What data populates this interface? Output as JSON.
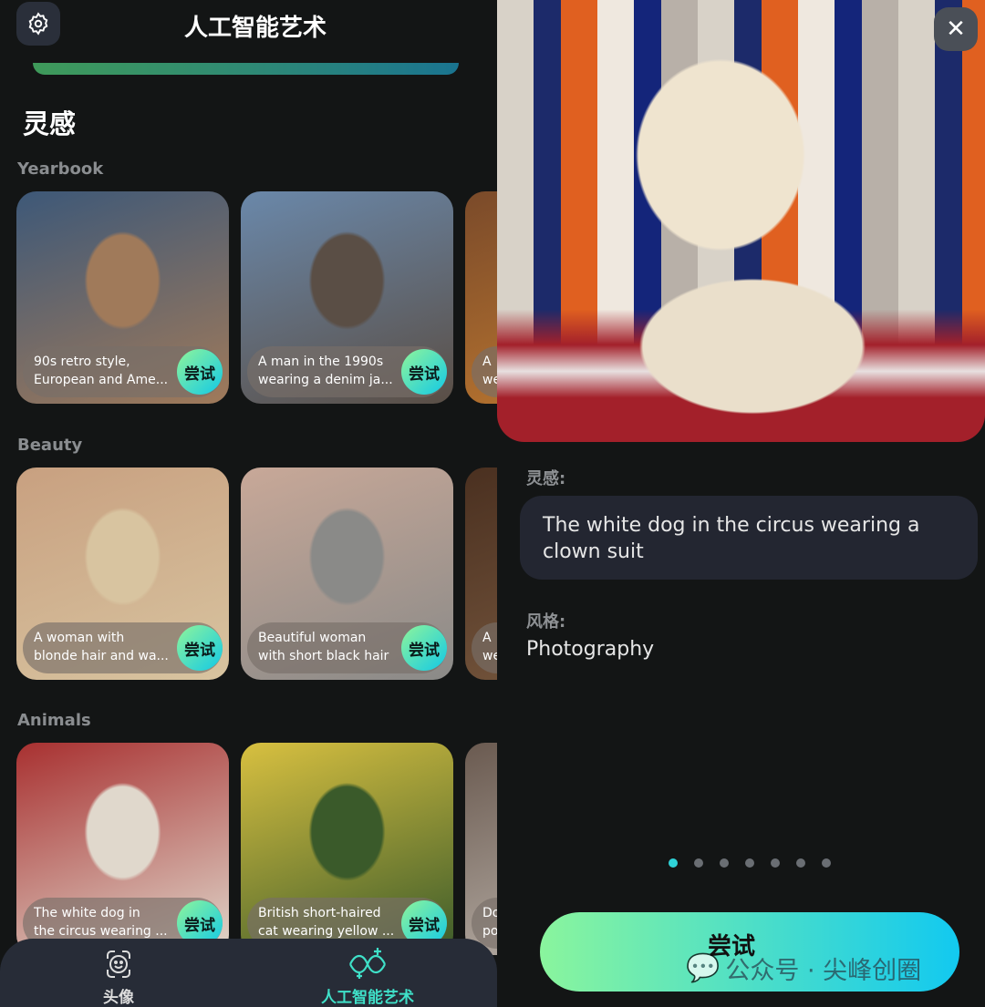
{
  "header": {
    "title": "人工智能艺术",
    "settings_icon": "gear-icon"
  },
  "section_title": "灵感",
  "categories": [
    {
      "name": "Yearbook",
      "cards": [
        {
          "caption": "90s retro style,\nEuropean and Ame...",
          "try": "尝试",
          "colors": [
            "#a07a5a",
            "#3d5878"
          ]
        },
        {
          "caption": "A man in the 1990s\nwearing a denim ja...",
          "try": "尝试",
          "colors": [
            "#5a4e45",
            "#6a88aa"
          ]
        },
        {
          "caption": "A\nwe",
          "try": "尝试",
          "colors": [
            "#c07a30",
            "#7a4a2a"
          ]
        }
      ]
    },
    {
      "name": "Beauty",
      "cards": [
        {
          "caption": "A woman with\nblonde hair and wa...",
          "try": "尝试",
          "colors": [
            "#d8c4a0",
            "#c8a080"
          ]
        },
        {
          "caption": "Beautiful woman\nwith short black hair",
          "try": "尝试",
          "colors": [
            "#8a8a88",
            "#c8a898"
          ]
        },
        {
          "caption": "A\nwe",
          "try": "尝试",
          "colors": [
            "#7a5a40",
            "#4a3020"
          ]
        }
      ]
    },
    {
      "name": "Animals",
      "cards": [
        {
          "caption": "The white dog in\nthe circus wearing ...",
          "try": "尝试",
          "colors": [
            "#e0d8cc",
            "#a83030"
          ]
        },
        {
          "caption": "British short-haired\ncat wearing yellow ...",
          "try": "尝试",
          "colors": [
            "#3a5a2a",
            "#d8c040"
          ]
        },
        {
          "caption": "Do\npo",
          "try": "尝试",
          "colors": [
            "#c0b8b0",
            "#6a5a50"
          ]
        }
      ]
    }
  ],
  "nav": {
    "items": [
      {
        "label": "头像",
        "icon": "face-scan-icon",
        "active": false
      },
      {
        "label": "人工智能艺术",
        "icon": "ai-art-icon",
        "active": true
      }
    ]
  },
  "detail": {
    "inspiration_label": "灵感:",
    "prompt": "The white dog in the circus wearing a clown suit",
    "style_label": "风格:",
    "style": "Photography",
    "page_count": 7,
    "current_page": 1,
    "try_label": "尝试",
    "close_icon": "close-icon"
  },
  "watermark": "公众号 · 尖峰创圈",
  "colors": {
    "accent_start": "#8af59d",
    "accent_end": "#12c9f0",
    "background": "#131515",
    "nav": "#272c37"
  }
}
